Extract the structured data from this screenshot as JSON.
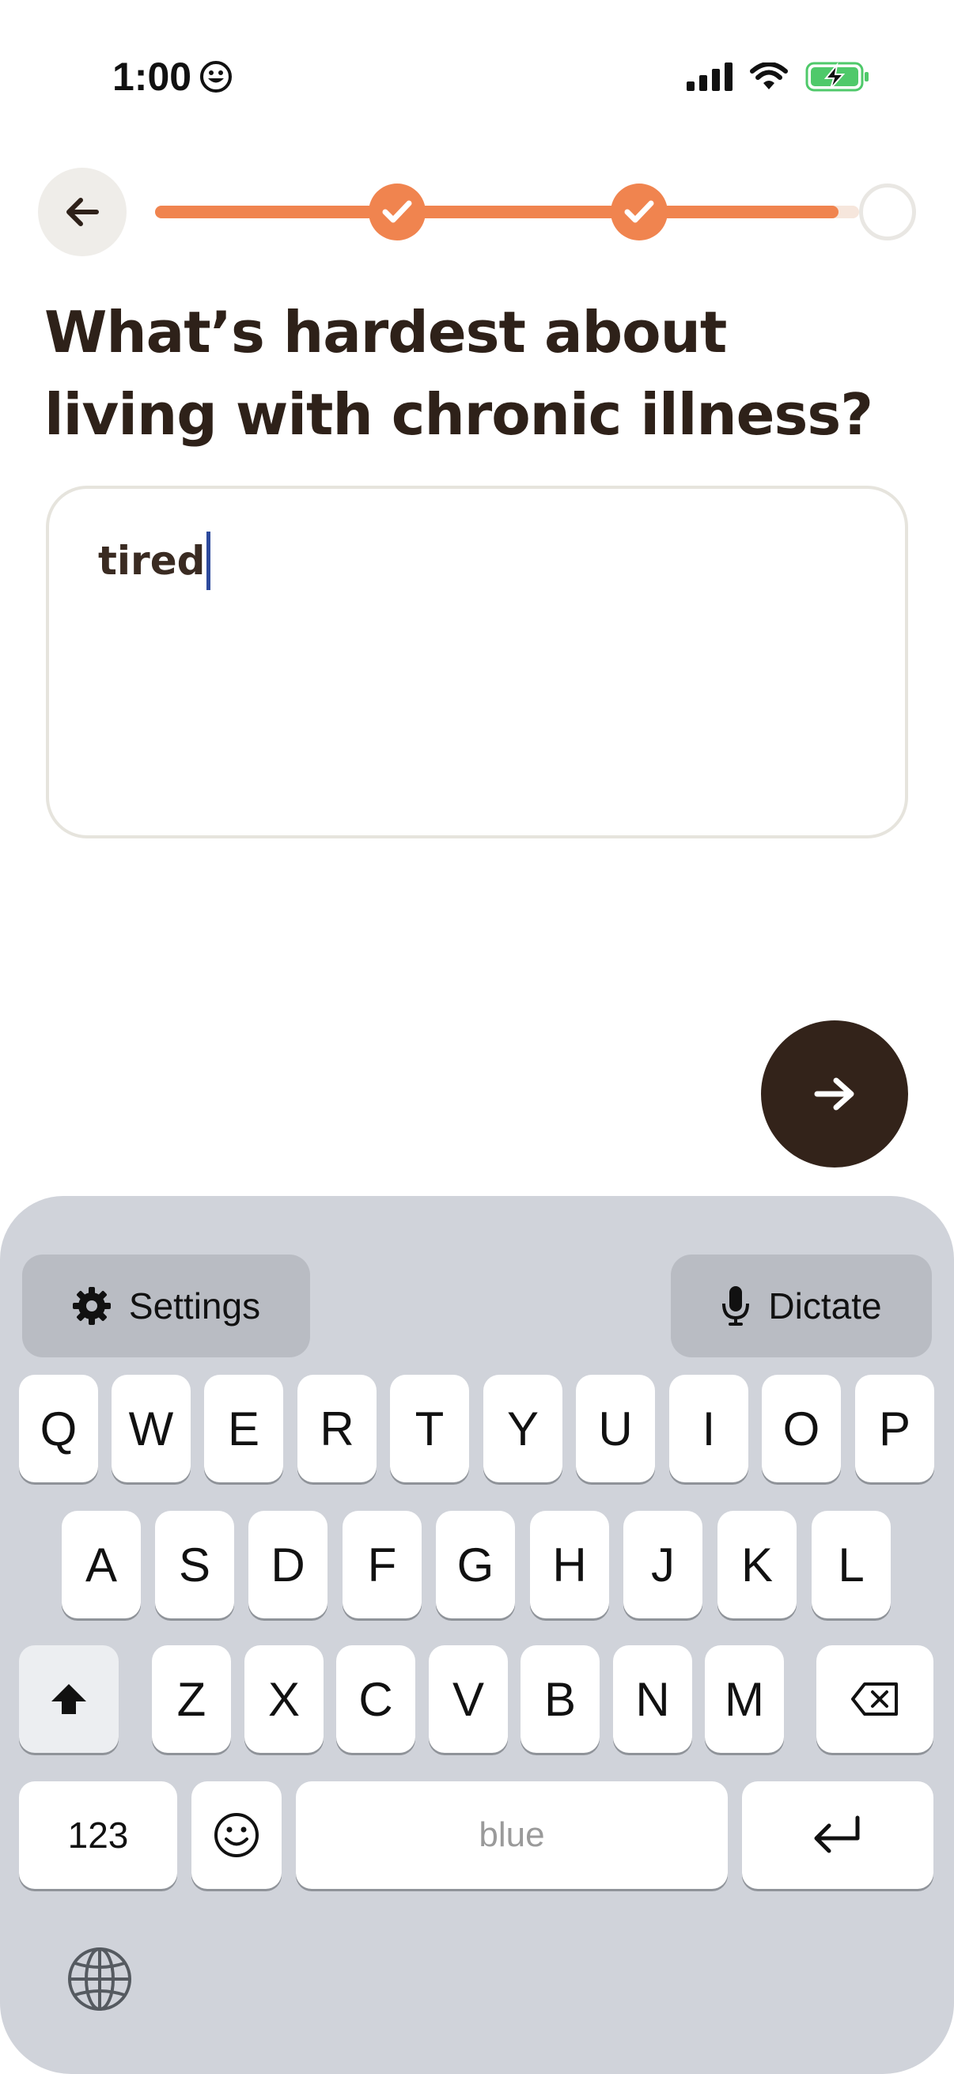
{
  "status_bar": {
    "time": "1:00",
    "icons": [
      "emoji-smile-icon",
      "signal-icon",
      "wifi-icon",
      "battery-charging-icon"
    ]
  },
  "nav": {
    "back_icon": "arrow-left-icon",
    "progress": {
      "total_steps": 3,
      "completed_steps": 2
    }
  },
  "question": {
    "title": "What’s hardest about living with chronic illness?"
  },
  "answer": {
    "value": "tired"
  },
  "next_button": {
    "icon": "arrow-right-icon"
  },
  "keyboard": {
    "settings_label": "Settings",
    "dictate_label": "Dictate",
    "row1": [
      "Q",
      "W",
      "E",
      "R",
      "T",
      "Y",
      "U",
      "I",
      "O",
      "P"
    ],
    "row2": [
      "A",
      "S",
      "D",
      "F",
      "G",
      "H",
      "J",
      "K",
      "L"
    ],
    "row3": [
      "Z",
      "X",
      "C",
      "V",
      "B",
      "N",
      "M"
    ],
    "numbers_label": "123",
    "space_label": "blue"
  },
  "colors": {
    "accent": "#f0844f",
    "dark": "#33231a",
    "keyboard_bg": "#d0d3da"
  }
}
